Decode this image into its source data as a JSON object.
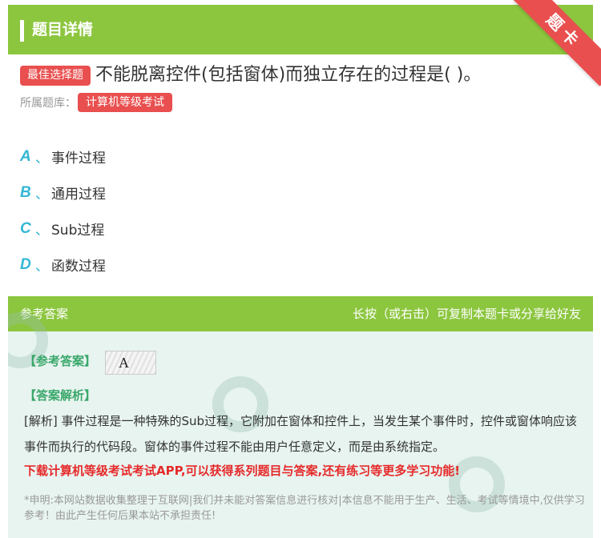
{
  "header": {
    "title": "题目详情",
    "ribbon": "题卡"
  },
  "question": {
    "type_badge": "最佳选择题",
    "text": "不能脱离控件(包括窗体)而独立存在的过程是( )。",
    "library_label": "所属题库：",
    "library_name": "计算机等级考试"
  },
  "options": [
    {
      "letter": "A",
      "sep": "、",
      "text": "事件过程"
    },
    {
      "letter": "B",
      "sep": "、",
      "text": "通用过程"
    },
    {
      "letter": "C",
      "sep": "、",
      "text": "Sub过程"
    },
    {
      "letter": "D",
      "sep": "、",
      "text": "函数过程"
    }
  ],
  "answer": {
    "header_left": "参考答案",
    "header_right": "长按（或右击）可复制本题卡或分享给好友",
    "answer_label": "【参考答案】",
    "answer_value": "A",
    "analysis_label": "【答案解析】",
    "analysis_text": "[解析] 事件过程是一种特殊的Sub过程，它附加在窗体和控件上，当发生某个事件时，控件或窗体响应该事件而执行的代码段。窗体的事件过程不能由用户任意定义，而是由系统指定。",
    "promo": "下载计算机等级考试考试APP,可以获得系列题目与答案,还有练习等更多学习功能!",
    "disclaimer": "*申明:本网站数据收集整理于互联网|我们并未能对答案信息进行核对|本信息不能用于生产、生活、考试等情境中,仅供学习参考！由此产生任何后果本站不承担责任!"
  },
  "colors": {
    "brand_green": "#8cc63f",
    "badge_red": "#e94f4f",
    "option_blue": "#33b7d4",
    "answer_green": "#3aa86b",
    "promo_red": "#e62a2a"
  }
}
